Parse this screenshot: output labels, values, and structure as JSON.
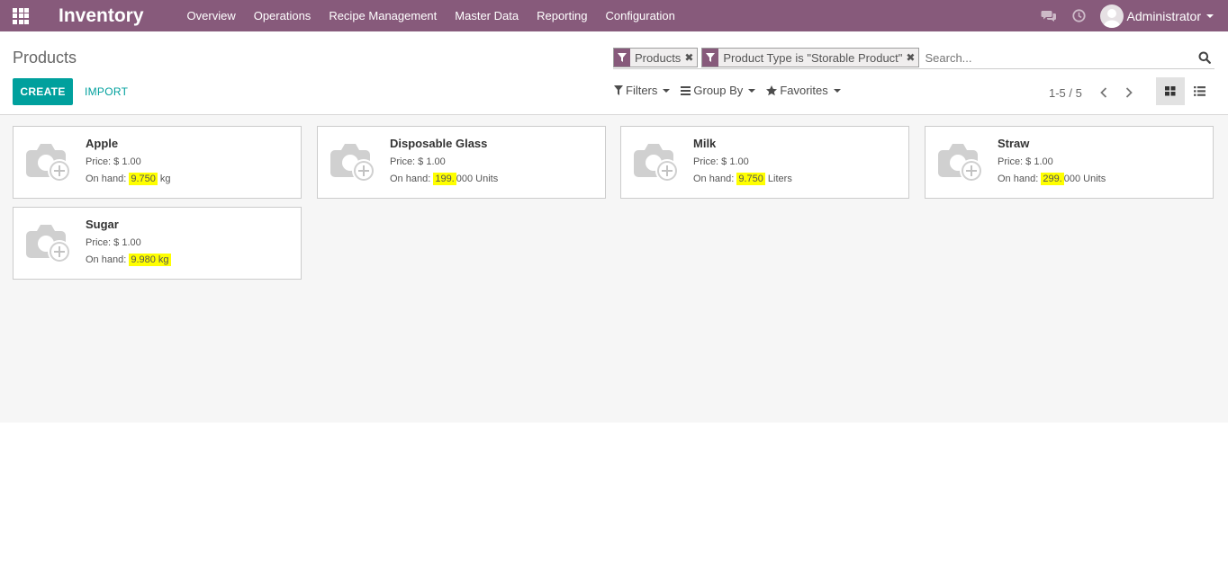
{
  "app": {
    "title": "Inventory"
  },
  "nav": {
    "menu": [
      "Overview",
      "Operations",
      "Recipe Management",
      "Master Data",
      "Reporting",
      "Configuration"
    ],
    "user": "Administrator"
  },
  "breadcrumb": "Products",
  "buttons": {
    "create": "CREATE",
    "import": "IMPORT"
  },
  "search": {
    "facets": [
      "Products",
      "Product Type is \"Storable Product\""
    ],
    "placeholder": "Search..."
  },
  "filters": {
    "filters": "Filters",
    "group_by": "Group By",
    "favorites": "Favorites"
  },
  "pager": {
    "value": "1-5 / 5"
  },
  "colors": {
    "brand": "#875a7b",
    "accent": "#00a09d",
    "highlight": "#ffff00"
  },
  "products": [
    {
      "name": "Apple",
      "price": "Price: $ 1.00",
      "on_hand_label": "On hand:",
      "hl": "9.750",
      "rest": " kg"
    },
    {
      "name": "Disposable Glass",
      "price": "Price: $ 1.00",
      "on_hand_label": "On hand:",
      "hl": "199.",
      "rest": "000 Units"
    },
    {
      "name": "Milk",
      "price": "Price: $ 1.00",
      "on_hand_label": "On hand:",
      "hl": "9.750",
      "rest": " Liters"
    },
    {
      "name": "Straw",
      "price": "Price: $ 1.00",
      "on_hand_label": "On hand:",
      "hl": "299.",
      "rest": "000 Units"
    },
    {
      "name": "Sugar",
      "price": "Price: $ 1.00",
      "on_hand_label": "On hand:",
      "hl": "9.980 kg",
      "rest": ""
    }
  ]
}
